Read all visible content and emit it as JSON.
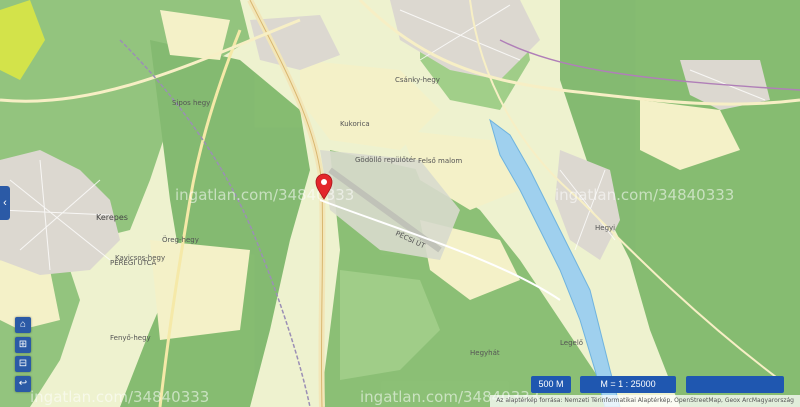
{
  "map": {
    "places": {
      "kerepes": "Kerepes",
      "godollo_airport": "Gödöllő repülőtér",
      "felso_malom": "Felső malom",
      "ore_hegy": "Öreg-hegy",
      "fenyo_hegy": "Fenyő-hegy",
      "kukorica": "Kukorica",
      "sipos_hegy": "Sipos hegy",
      "csanky_hegy": "Csánky-hegy",
      "pecsi_ut": "PÉCSI ÚT",
      "pereg_utcai": "PEREGI UTCA",
      "hegyi": "Hegyi",
      "leg": "Legelő",
      "hegyhat": "Hegyhát",
      "kavicsos": "Kavicsos-hegy"
    },
    "watermark": "ingatlan.com/34840333"
  },
  "controls": {
    "home_icon": "⌂",
    "zoom_in_icon": "⊞",
    "zoom_out_icon": "⊟",
    "back_icon": "↩",
    "side_toggle_icon": "‹"
  },
  "scalebar": {
    "scale_distance": "500 M",
    "ratio": "M = 1 : 25000"
  },
  "attribution": "Az alaptérkép forrása: Nemzeti Térinformatikai Alaptérkép, OpenStreetMap, Geox ArcMagyarország"
}
